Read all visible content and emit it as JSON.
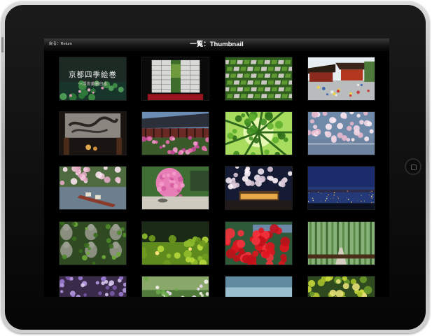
{
  "nav": {
    "return_label": "戻る：Return",
    "title": "一覧：Thumbnail"
  },
  "cover": {
    "title": "京都四季絵巻",
    "subtitle": "～浮世美景日本"
  },
  "thumbnails": [
    {
      "name": "thumb-cover-water-lilies",
      "kind": "cover"
    },
    {
      "name": "thumb-shoji-window-garden",
      "kind": "shoji"
    },
    {
      "name": "thumb-checkerboard-moss-garden",
      "kind": "checker"
    },
    {
      "name": "thumb-shrine-festival",
      "kind": "shrine"
    },
    {
      "name": "thumb-dragon-ceiling-painting",
      "kind": "dragon"
    },
    {
      "name": "thumb-temple-cherry-blossoms",
      "kind": "temple-sakura"
    },
    {
      "name": "thumb-bamboo-canopy",
      "kind": "bamboo-canopy"
    },
    {
      "name": "thumb-cherry-blossom-river",
      "kind": "sakura-river"
    },
    {
      "name": "thumb-boat-canal-blossoms",
      "kind": "boat"
    },
    {
      "name": "thumb-weeping-cherry-rock-garden",
      "kind": "weeping"
    },
    {
      "name": "thumb-blossoms-night-temple",
      "kind": "night-sakura"
    },
    {
      "name": "thumb-city-night-view",
      "kind": "night-city"
    },
    {
      "name": "thumb-stone-buddhas",
      "kind": "buddhas"
    },
    {
      "name": "thumb-moss-garden-lanterns",
      "kind": "lantern-garden"
    },
    {
      "name": "thumb-red-azaleas",
      "kind": "azalea"
    },
    {
      "name": "thumb-bamboo-path",
      "kind": "bamboo-path"
    },
    {
      "name": "thumb-wisteria-pond",
      "kind": "wisteria"
    },
    {
      "name": "thumb-garden-flowers",
      "kind": "flowers"
    },
    {
      "name": "thumb-misty-river",
      "kind": "misty"
    },
    {
      "name": "thumb-autumn-trees",
      "kind": "autumn"
    }
  ],
  "colors": {
    "screen_background": "#000000",
    "title_text": "#ffffff"
  },
  "icons": {
    "home_button": "home-button-icon"
  }
}
